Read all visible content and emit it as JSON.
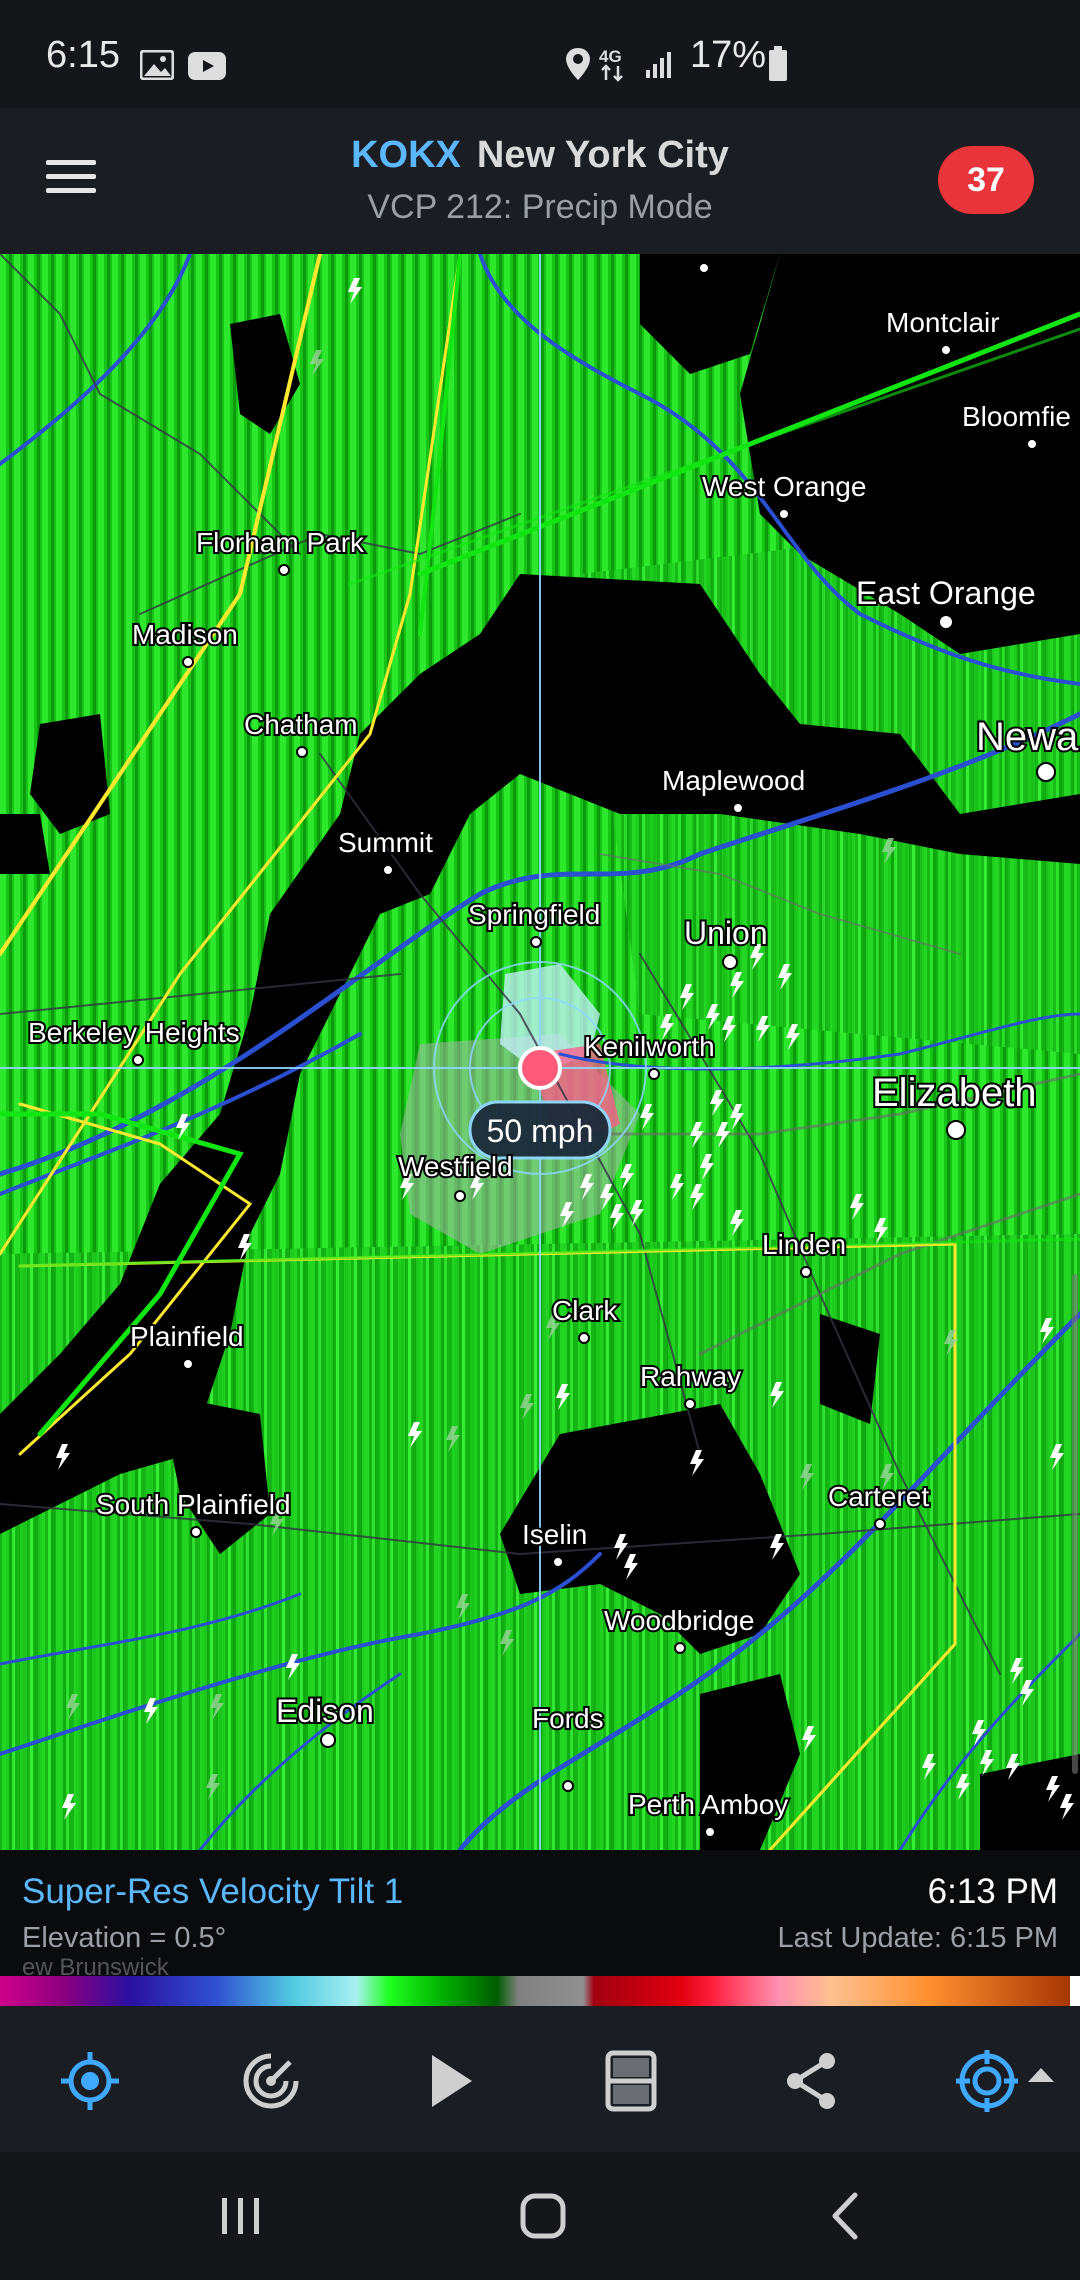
{
  "status_bar": {
    "time": "6:15",
    "network": "4G",
    "battery": "17%",
    "icons": [
      "image-icon",
      "youtube-icon",
      "location-icon",
      "signal-icon",
      "battery-icon"
    ]
  },
  "header": {
    "station": "KOKX",
    "city": "New York City",
    "mode": "VCP 212: Precip Mode",
    "alert_count": "37",
    "alert_color": "#e8343a",
    "accent_color": "#5bb8ff"
  },
  "map": {
    "cities": {
      "montclair": "Montclair",
      "bloomfield": "Bloomfie",
      "west_orange": "West Orange",
      "florham_park": "Florham Park",
      "east_orange": "East Orange",
      "madison": "Madison",
      "chatham": "Chatham",
      "newark": "Newa",
      "maplewood": "Maplewood",
      "summit": "Summit",
      "springfield": "Springfield",
      "union": "Union",
      "berkeley_heights": "Berkeley Heights",
      "kenilworth": "Kenilworth",
      "elizabeth": "Elizabeth",
      "westfield": "Westfield",
      "linden": "Linden",
      "clark": "Clark",
      "plainfield": "Plainfield",
      "rahway": "Rahway",
      "south_plainfield": "South Plainfield",
      "carteret": "Carteret",
      "iselin": "Iselin",
      "woodbridge": "Woodbridge",
      "edison": "Edison",
      "fords": "Fords",
      "perth_amboy": "Perth Amboy",
      "new_brunswick": "ew Brunswick"
    },
    "velocity_readout": "50 mph"
  },
  "product": {
    "name": "Super-Res Velocity Tilt 1",
    "elevation": "Elevation = 0.5°",
    "time": "6:13 PM",
    "last_update": "Last Update: 6:15 PM"
  },
  "toolbar": {
    "buttons": [
      "locate-icon",
      "radar-icon",
      "play-icon",
      "layout-icon",
      "share-icon",
      "target-icon"
    ]
  },
  "nav": {
    "buttons": [
      "recent-apps-icon",
      "home-icon",
      "back-icon"
    ]
  }
}
